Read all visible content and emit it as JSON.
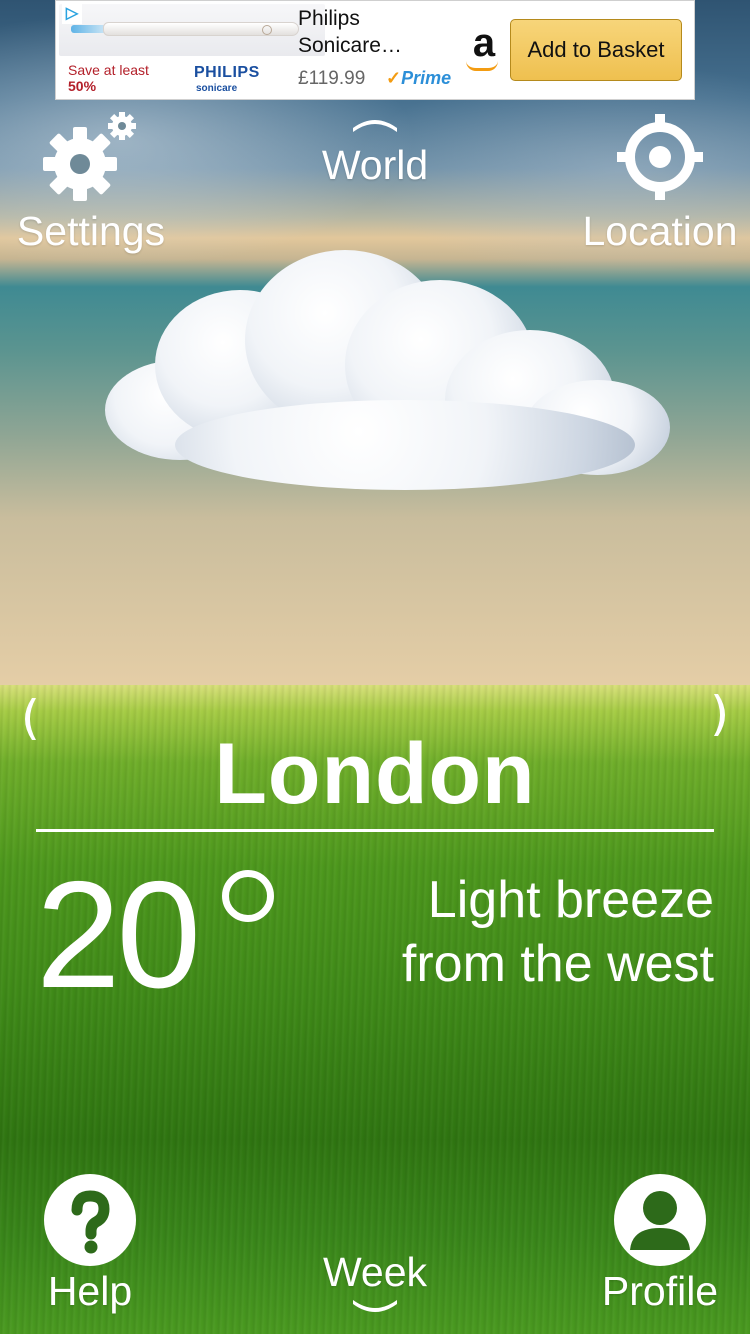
{
  "ad": {
    "discount_prefix": "Save at least",
    "discount_value": "50%",
    "brand": "PHILIPS",
    "brand_sub": "sonicare",
    "product_title": "Philips Sonicare…",
    "price": "£119.99",
    "prime_label": "Prime",
    "amazon_logo": "a",
    "cta_label": "Add to Basket",
    "adchoices_icon": "adchoices-icon"
  },
  "nav": {
    "settings_label": "Settings",
    "world_label": "World",
    "location_label": "Location",
    "help_label": "Help",
    "week_label": "Week",
    "profile_label": "Profile"
  },
  "weather": {
    "city": "London",
    "temperature": "20",
    "wind_line1": "Light breeze",
    "wind_line2": "from the west",
    "condition_icon": "cloud"
  },
  "colors": {
    "accent_text": "#ffffff",
    "cta_bg": "#efc04f",
    "sale_red": "#b3202a",
    "brand_blue": "#1a4fa0"
  }
}
